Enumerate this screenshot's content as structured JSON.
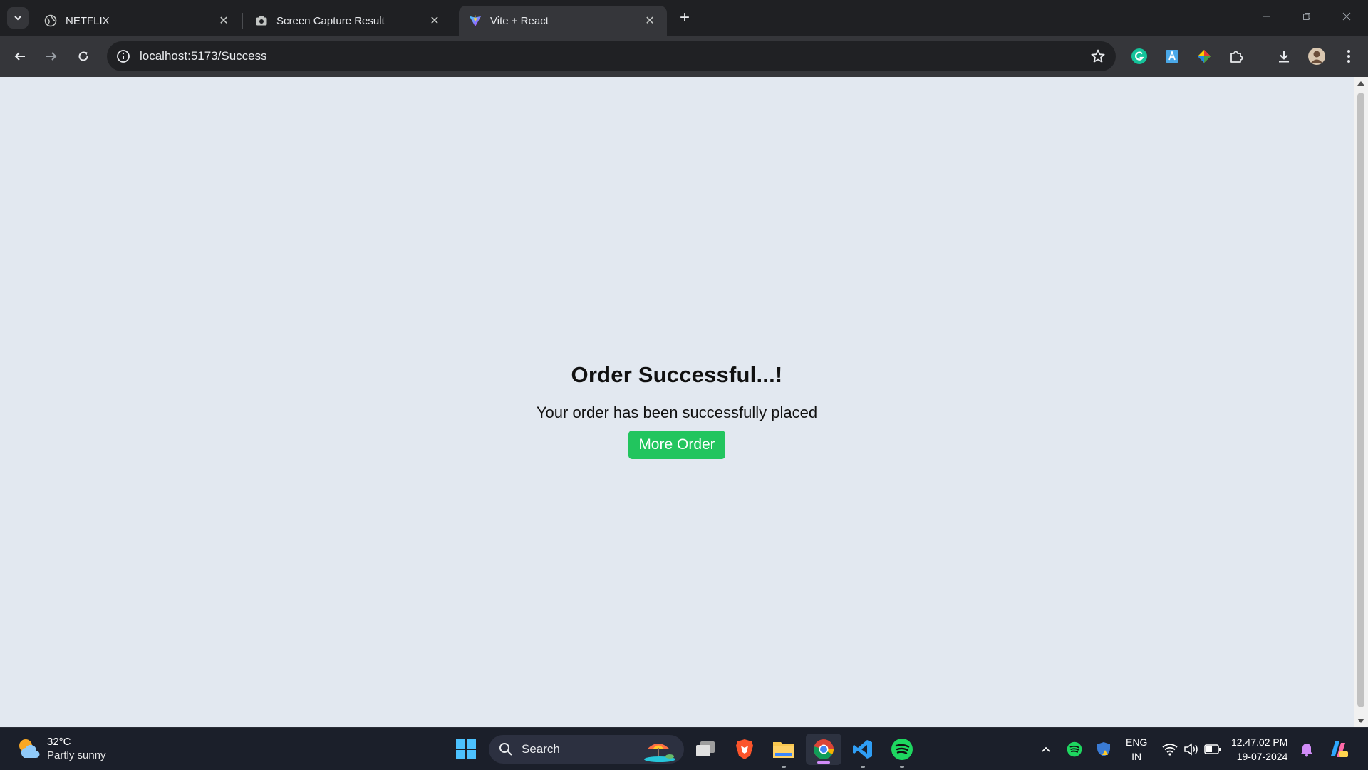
{
  "browser": {
    "tabs": [
      {
        "title": "NETFLIX",
        "icon": "globe-icon",
        "active": false
      },
      {
        "title": "Screen Capture Result",
        "icon": "camera-icon",
        "active": false
      },
      {
        "title": "Vite + React",
        "icon": "vite-icon",
        "active": true
      }
    ],
    "address": "localhost:5173/Success"
  },
  "page": {
    "title": "Order Successful...!",
    "message": "Your order has been successfully placed",
    "button_label": "More Order",
    "background": "#e2e8f0",
    "button_color": "#22c55e"
  },
  "taskbar": {
    "weather_temp": "32°C",
    "weather_condition": "Partly sunny",
    "search_label": "Search",
    "lang_top": "ENG",
    "lang_bottom": "IN",
    "time": "12.47.02 PM",
    "date": "19-07-2024"
  }
}
